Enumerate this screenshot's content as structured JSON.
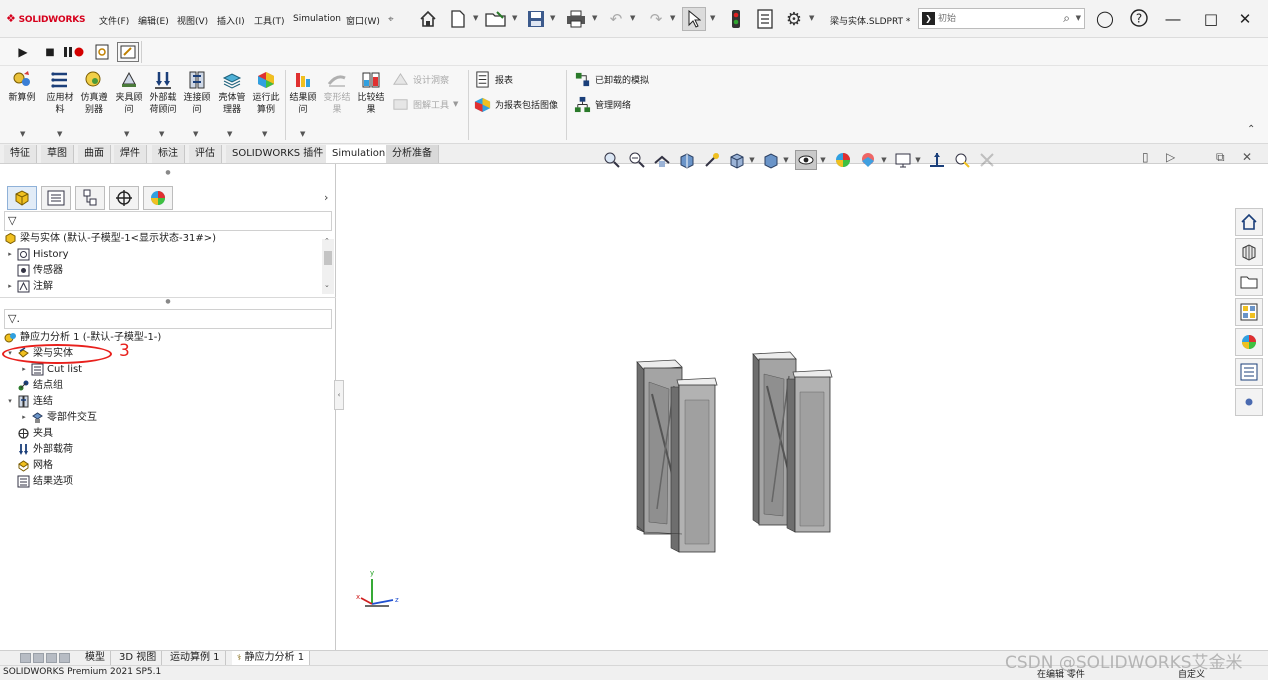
{
  "app": {
    "logo_text": "SOLIDWORKS",
    "menu": [
      "文件(F)",
      "编辑(E)",
      "视图(V)",
      "插入(I)",
      "工具(T)",
      "Simulation",
      "窗口(W)"
    ],
    "filename": "梁与实体.SLDPRT *",
    "search_placeholder": "初始",
    "pin_icon": "pin-icon"
  },
  "command_manager": {
    "large_buttons": [
      {
        "label": "新算例",
        "icon": "new-study-icon"
      },
      {
        "label": "应用材料",
        "icon": "apply-material-icon"
      },
      {
        "label": "仿真遵别器",
        "icon": "simulation-advisor-icon"
      },
      {
        "label": "夹具顾问",
        "icon": "fixtures-advisor-icon"
      },
      {
        "label": "外部载荷顾问",
        "icon": "external-loads-icon"
      },
      {
        "label": "连接顾问",
        "icon": "connections-advisor-icon"
      },
      {
        "label": "壳体管理器",
        "icon": "shell-manager-icon"
      },
      {
        "label": "运行此算例",
        "icon": "run-study-icon"
      },
      {
        "label": "结果顾问",
        "icon": "results-advisor-icon"
      },
      {
        "label": "变形结果",
        "icon": "deformed-result-icon",
        "disabled": true
      },
      {
        "label": "比较结果",
        "icon": "compare-results-icon"
      }
    ],
    "small_buttons": [
      {
        "label": "设计洞察",
        "disabled": true
      },
      {
        "label": "图解工具",
        "disabled": true
      },
      {
        "label": "报表",
        "disabled": false
      },
      {
        "label": "为报表包括图像",
        "disabled": false
      },
      {
        "label": "已卸载的模拟",
        "disabled": false
      },
      {
        "label": "管理网络",
        "disabled": false
      }
    ]
  },
  "tabs": [
    "特征",
    "草图",
    "曲面",
    "焊件",
    "标注",
    "评估",
    "SOLIDWORKS 插件",
    "Simulation",
    "分析准备"
  ],
  "active_tab": "Simulation",
  "feature_tree": {
    "root": "梁与实体 (默认-子模型-1<显示状态-31#>)",
    "items": [
      "History",
      "传感器",
      "注解"
    ]
  },
  "simulation_tree": {
    "root": "静应力分析 1 (-默认-子模型-1-)",
    "items": [
      {
        "label": "梁与实体",
        "indent": 1,
        "expanded": true
      },
      {
        "label": "Cut list",
        "indent": 2,
        "expanded": false
      },
      {
        "label": "结点组",
        "indent": 1
      },
      {
        "label": "连结",
        "indent": 1,
        "expanded": true
      },
      {
        "label": "零部件交互",
        "indent": 2,
        "expanded": false
      },
      {
        "label": "夹具",
        "indent": 1
      },
      {
        "label": "外部载荷",
        "indent": 1
      },
      {
        "label": "网格",
        "indent": 1
      },
      {
        "label": "结果选项",
        "indent": 1
      }
    ]
  },
  "annotation_number": "3",
  "bottom_tabs": [
    "模型",
    "3D 视图",
    "运动算例 1",
    "静应力分析 1"
  ],
  "active_bottom_tab": "静应力分析 1",
  "status": {
    "left": "SOLIDWORKS Premium 2021 SP5.1",
    "editing": "在编辑 零件",
    "units": "自定义"
  },
  "triad": {
    "x": "x",
    "y": "y",
    "z": "z"
  },
  "watermark": "CSDN @SOLIDWORKS艾金米",
  "colors": {
    "accent_red": "#e8201c",
    "brand_red": "#d6001c",
    "model_grey": "#9a9a9a"
  }
}
